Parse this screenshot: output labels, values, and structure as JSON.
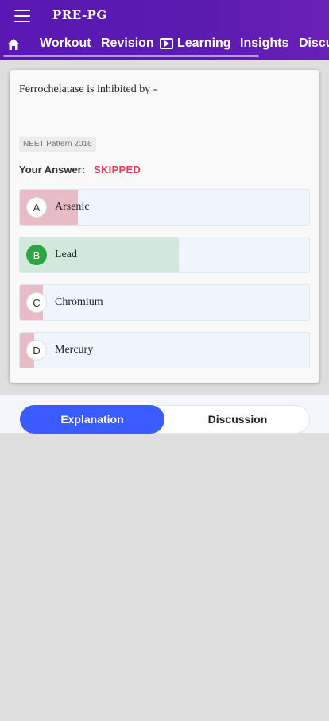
{
  "app": {
    "title": "PRE-PG"
  },
  "colors": {
    "appbar": "#5a17b4",
    "accent": "#3a5cff",
    "skipped": "#d8425b",
    "correct": "#2aa642",
    "wrong_fill": "#e8bcc6",
    "correct_fill": "#d2e8dc"
  },
  "icons": {
    "menu": "hamburger-menu-icon",
    "home": "home-icon",
    "learning": "play-box-icon"
  },
  "tabs": [
    {
      "label": "Workout"
    },
    {
      "label": "Revision"
    },
    {
      "label": "Learning"
    },
    {
      "label": "Insights"
    },
    {
      "label": "Discu"
    }
  ],
  "question": {
    "text": "Ferrochelatase is inhibited by -",
    "tag": "NEET Pattern 2016",
    "answer_label": "Your Answer:",
    "answer_value": "SKIPPED"
  },
  "options": [
    {
      "letter": "A",
      "text": "Arsenic",
      "share_pct": 20,
      "correct": false
    },
    {
      "letter": "B",
      "text": "Lead",
      "share_pct": 55,
      "correct": true
    },
    {
      "letter": "C",
      "text": "Chromium",
      "share_pct": 8,
      "correct": false
    },
    {
      "letter": "D",
      "text": "Mercury",
      "share_pct": 5,
      "correct": false
    }
  ],
  "segmented": {
    "explanation_label": "Explanation",
    "discussion_label": "Discussion",
    "active": "Explanation"
  }
}
